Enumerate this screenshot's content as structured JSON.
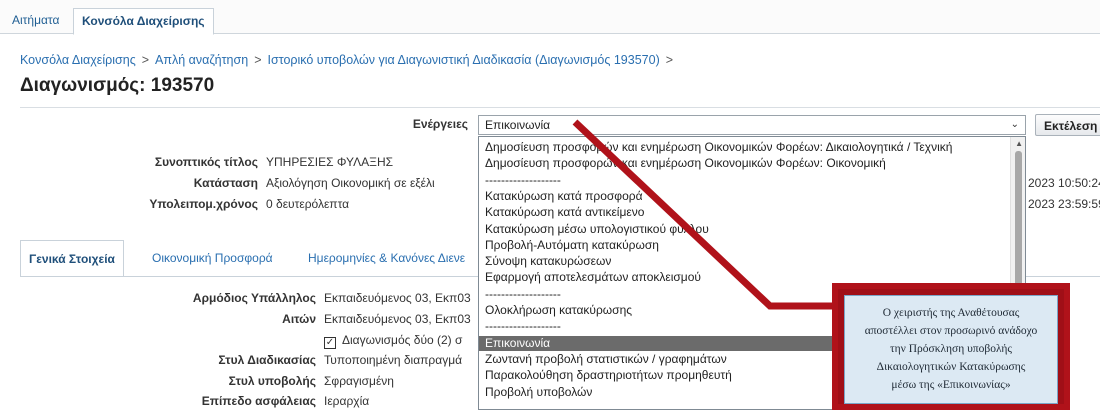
{
  "top_tabs": [
    {
      "label": "Αιτήματα"
    },
    {
      "label": "Κονσόλα Διαχείρισης"
    }
  ],
  "breadcrumb": [
    {
      "label": "Κονσόλα Διαχείρισης"
    },
    {
      "label": "Απλή αναζήτηση"
    },
    {
      "label": "Ιστορικό υποβολών για Διαγωνιστική Διαδικασία (Διαγωνισμός 193570)"
    }
  ],
  "breadcrumb_sep": ">",
  "page_title": "Διαγωνισμός: 193570",
  "actions": {
    "label": "Ενέργειες",
    "selected_value": "Επικοινωνία",
    "execute_label": "Εκτέλεση"
  },
  "summary": {
    "title_label": "Συνοπτικός τίτλος",
    "title_value": "ΥΠΗΡΕΣΙΕΣ ΦΥΛΑΞΗΣ",
    "status_label": "Κατάσταση",
    "status_value": "Αξιολόγηση Οικονομική σε εξέλι",
    "remaining_label": "Υπολειπομ.χρόνος",
    "remaining_value": "0 δευτερόλεπτα",
    "date1": "2023 10:50:24",
    "date2": "2023 23:59:59"
  },
  "dropdown_items": [
    "Δημοσίευση προσφορών και ενημέρωση Οικονομικών Φορέων: Δικαιολογητικά / Τεχνική",
    "Δημοσίευση προσφορών και ενημέρωση Οικονομικών Φορέων: Οικονομική",
    "-------------------",
    "Κατακύρωση κατά προσφορά",
    "Κατακύρωση κατά αντικείμενο",
    "Κατακύρωση μέσω υπολογιστικού φύλλου",
    "Προβολή-Αυτόματη κατακύρωση",
    "Σύνοψη κατακυρώσεων",
    "Εφαρμογή αποτελεσμάτων αποκλεισμού",
    "-------------------",
    "Ολοκλήρωση κατακύρωσης",
    "-------------------",
    "Επικοινωνία",
    "Ζωντανή προβολή στατιστικών / γραφημάτων",
    "Παρακολούθηση δραστηριοτήτων προμηθευτή",
    "Προβολή υποβολών"
  ],
  "selected_index": 12,
  "section_tabs": [
    {
      "label": "Γενικά Στοιχεία"
    },
    {
      "label": "Οικονομική Προσφορά"
    },
    {
      "label": "Ημερομηνίες & Κανόνες Διενε"
    }
  ],
  "details": {
    "officer_label": "Αρμόδιος Υπάλληλος",
    "officer_value": "Εκπαιδευόμενος 03, Εκπ03",
    "requester_label": "Αιτών",
    "requester_value": "Εκπαιδευόμενος 03, Εκπ03",
    "two_stage_checkbox": "Διαγωνισμός δύο (2) σ",
    "procedure_style_label": "Στυλ Διαδικασίας",
    "procedure_style_value": "Τυποποιημένη διαπραγμά",
    "submission_style_label": "Στυλ υποβολής",
    "submission_style_value": "Σφραγισμένη",
    "security_label": "Επίπεδο ασφάλειας",
    "security_value": "Ιεραρχία"
  },
  "callout_text": [
    "Ο χειριστής της Αναθέτουσας",
    "αποστέλλει στον προσωρινό ανάδοχο",
    "την Πρόσκληση υποβολής",
    "Δικαιολογητικών Κατακύρωσης",
    "μέσω της «Επικοινωνίας»"
  ],
  "colors": {
    "accent_link": "#2a6fb0",
    "callout_red": "#b0121a",
    "callout_fill": "#dce9f3",
    "selected_item": "#6b6b6b"
  }
}
